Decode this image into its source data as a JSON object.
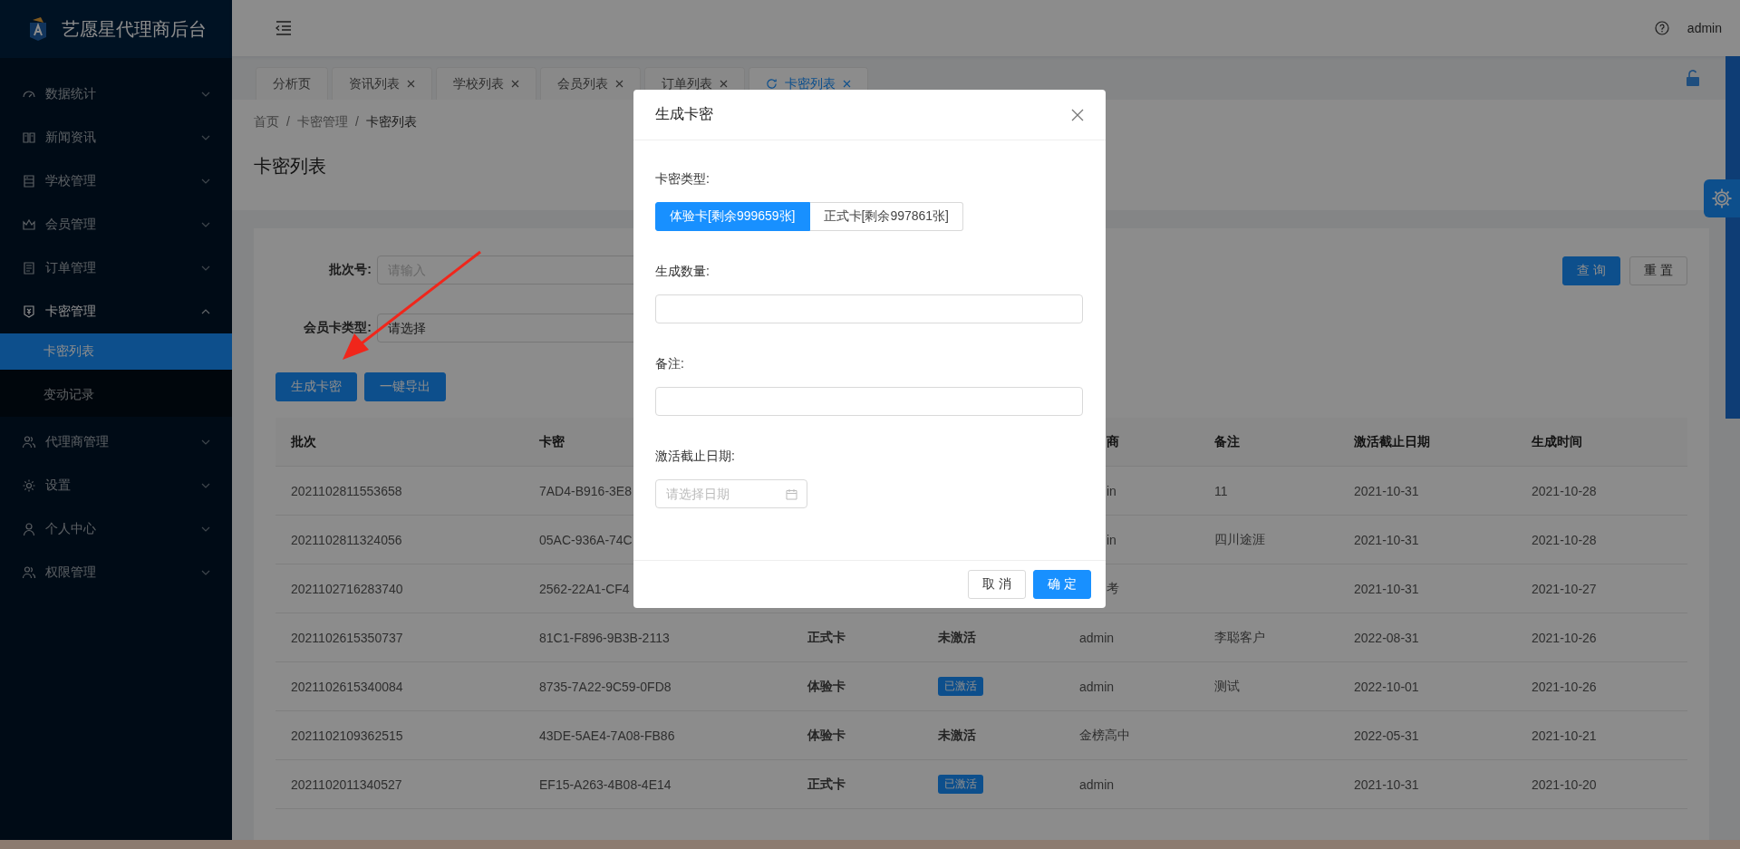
{
  "app": {
    "title": "艺愿星代理商后台"
  },
  "sidebar": {
    "items": [
      {
        "label": "数据统计",
        "expanded": false
      },
      {
        "label": "新闻资讯",
        "expanded": false
      },
      {
        "label": "学校管理",
        "expanded": false
      },
      {
        "label": "会员管理",
        "expanded": false
      },
      {
        "label": "订单管理",
        "expanded": false
      },
      {
        "label": "卡密管理",
        "expanded": true,
        "children": [
          {
            "label": "卡密列表",
            "selected": true
          },
          {
            "label": "变动记录",
            "selected": false
          }
        ]
      },
      {
        "label": "代理商管理",
        "expanded": false
      },
      {
        "label": "设置",
        "expanded": false
      },
      {
        "label": "个人中心",
        "expanded": false
      },
      {
        "label": "权限管理",
        "expanded": false
      }
    ]
  },
  "header": {
    "user": "admin"
  },
  "tabs": [
    {
      "label": "分析页",
      "closable": false,
      "selected": false
    },
    {
      "label": "资讯列表",
      "closable": true,
      "selected": false
    },
    {
      "label": "学校列表",
      "closable": true,
      "selected": false
    },
    {
      "label": "会员列表",
      "closable": true,
      "selected": false
    },
    {
      "label": "订单列表",
      "closable": true,
      "selected": false
    },
    {
      "label": "卡密列表",
      "closable": true,
      "selected": true
    }
  ],
  "breadcrumb": [
    {
      "label": "首页"
    },
    {
      "separator": "/",
      "label": "卡密管理"
    },
    {
      "separator": "/",
      "label": "卡密列表"
    }
  ],
  "page_title": "卡密列表",
  "filters": [
    {
      "label": "批次号:",
      "placeholder": "请输入"
    },
    {
      "label": "会员卡类型:",
      "placeholder": "请选择"
    }
  ],
  "search_buttons": [
    {
      "label": "查 询",
      "primary": true
    },
    {
      "label": "重 置",
      "primary": false
    }
  ],
  "actions": [
    "生成卡密",
    "一键导出"
  ],
  "table": {
    "header": {
      "batch": "批次",
      "card": "卡密",
      "agent": "商",
      "remark": "备注",
      "expiry": "激活截止日期",
      "created": "生成时间",
      "covered": true
    },
    "rows": [
      {
        "batch": "2021102811553658",
        "card": "7AD4-B916-3E8",
        "agent": "in",
        "remark": "11",
        "expiry": "2021-10-31",
        "created": "2021-10-28",
        "covered": true
      },
      {
        "batch": "2021102811324056",
        "card": "05AC-936A-74C",
        "agent": "in",
        "remark": "四川途涯",
        "expiry": "2021-10-31",
        "created": "2021-10-28",
        "covered": true
      },
      {
        "batch": "2021102716283740",
        "card": "2562-22A1-CF4",
        "agent": "考",
        "expiry": "2021-10-31",
        "created": "2021-10-27",
        "covered": true
      },
      {
        "batch": "2021102615350737",
        "card": "81C1-F896-9B3B-2113",
        "type": "正式卡",
        "status": {
          "text": "未激活",
          "kind": "text"
        },
        "agent": "admin",
        "remark": "李聪客户",
        "expiry": "2022-08-31",
        "created": "2021-10-26"
      },
      {
        "batch": "2021102615340084",
        "card": "8735-7A22-9C59-0FD8",
        "type": "体验卡",
        "status": {
          "text": "已激活",
          "kind": "badge"
        },
        "agent": "admin",
        "remark": "测试",
        "expiry": "2022-10-01",
        "created": "2021-10-26"
      },
      {
        "batch": "2021102109362515",
        "card": "43DE-5AE4-7A08-FB86",
        "type": "体验卡",
        "status": {
          "text": "未激活",
          "kind": "text"
        },
        "agent": "金榜高中",
        "expiry": "2022-05-31",
        "created": "2021-10-21"
      },
      {
        "batch": "2021102011340527",
        "card": "EF15-A263-4B08-4E14",
        "type": "正式卡",
        "status": {
          "text": "已激活",
          "kind": "badge"
        },
        "agent": "admin",
        "expiry": "2021-10-31",
        "created": "2021-10-20"
      }
    ]
  },
  "modal": {
    "title": "生成卡密",
    "fields": [
      {
        "kind": "segmented",
        "label": "卡密类型:",
        "options": [
          {
            "label": "体验卡[剩余999659张]",
            "selected": true
          },
          {
            "label": "正式卡[剩余997861张]",
            "selected": false
          }
        ]
      },
      {
        "kind": "input",
        "label": "生成数量:"
      },
      {
        "kind": "input",
        "label": "备注:"
      },
      {
        "kind": "date",
        "label": "激活截止日期:",
        "placeholder": "请选择日期"
      }
    ],
    "buttons": [
      {
        "label": "取 消",
        "primary": false
      },
      {
        "label": "确 定",
        "primary": true
      }
    ]
  }
}
